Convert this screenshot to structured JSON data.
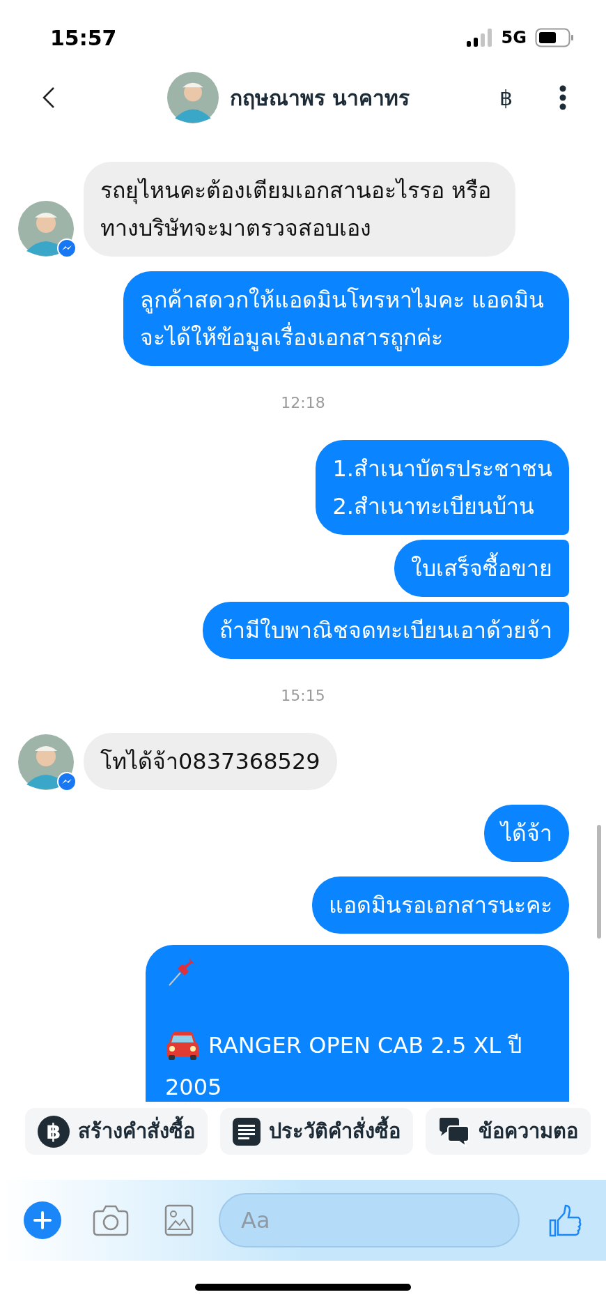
{
  "status_bar": {
    "time": "15:57",
    "network": "5G"
  },
  "header": {
    "contact_name": "กฤษณาพร นาคาทร",
    "currency_button": "฿"
  },
  "messages": [
    {
      "kind": "incoming",
      "bubbles": [
        "รถยุไหนคะต้องเตียมเอกสานอะไรรอ หรือทางบริษัทจะมาตรวจสอบเอง"
      ]
    },
    {
      "kind": "outgoing",
      "bubbles": [
        "ลูกค้าสดวกให้แอดมินโทรหาไมคะ แอดมินจะได้ให้ข้อมูลเรื่องเอกสารถูกค่ะ"
      ]
    },
    {
      "kind": "timestamp",
      "text": "12:18"
    },
    {
      "kind": "outgoing",
      "bubbles": [
        "1.สำเนาบัตรประชาชน\n2.สำเนาทะเบียนบ้าน",
        "ใบเสร็จซื้อขาย",
        "ถ้ามีใบพาณิชจดทะเบียนเอาด้วยจ้า"
      ]
    },
    {
      "kind": "timestamp",
      "text": "15:15"
    },
    {
      "kind": "incoming",
      "bubbles": [
        "โทได้จ้า0837368529"
      ]
    },
    {
      "kind": "outgoing",
      "bubbles": [
        "ได้จ้า"
      ]
    },
    {
      "kind": "outgoing",
      "bubbles": [
        "แอดมินรอเอกสารนะคะ"
      ]
    },
    {
      "kind": "listing",
      "lines": [
        "RANGER OPEN CAB 2.5 XL ปี",
        "2005"
      ]
    }
  ],
  "quick_actions": [
    {
      "kind": "currency",
      "icon_text": "฿",
      "label": "สร้างคำสั่งซื้อ"
    },
    {
      "kind": "history",
      "label": "ประวัติคำสั่งซื้อ"
    },
    {
      "kind": "messages",
      "label": "ข้อความตอ"
    }
  ],
  "composer": {
    "placeholder": "Aa"
  }
}
